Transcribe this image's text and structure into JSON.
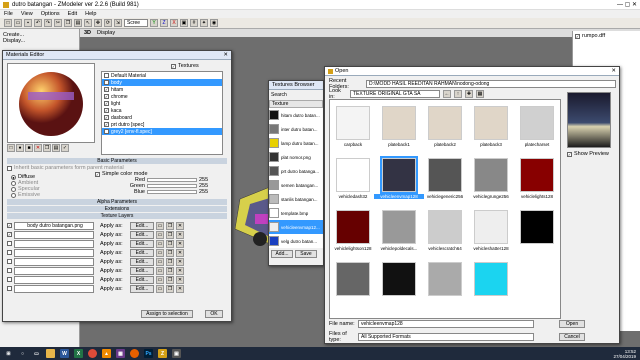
{
  "app": {
    "title": "dutro batangan - ZModeler ver 2.2.6 (Build 981)"
  },
  "menu": [
    "File",
    "View",
    "Options",
    "Edit",
    "Help"
  ],
  "toolbar": {
    "screen_label": "Scree"
  },
  "leftpanel": {
    "items": [
      "Create...",
      "Display..."
    ]
  },
  "viewport": {
    "tab": "3D",
    "display": "Display",
    "tree_item": "rumpo.dff"
  },
  "materials": {
    "title": "Materials Editor",
    "textures_label": "Textures",
    "items": [
      {
        "label": "Default Material",
        "checked": false
      },
      {
        "label": "body",
        "checked": false
      },
      {
        "label": "hitam",
        "checked": true
      },
      {
        "label": "chrome",
        "checked": true
      },
      {
        "label": "light",
        "checked": true
      },
      {
        "label": "kaca",
        "checked": true
      },
      {
        "label": "dasboard",
        "checked": true
      },
      {
        "label": "prt dutro [spec]",
        "checked": true
      },
      {
        "label": "grey2 [env-fl.spec]",
        "checked": true
      }
    ],
    "basic_params": "Basic Parameters",
    "inherit": "Inherit basic parameters form parent material",
    "diffuse": "Diffuse",
    "ambient": "Ambient",
    "specular": "Specular",
    "emissive": "Emissive",
    "simple_color": "Simple color mode",
    "red": "Red",
    "green": "Green",
    "blue": "Blue",
    "red_val": "255",
    "green_val": "255",
    "blue_val": "255",
    "alpha": "Alpha Parameters",
    "extensions": "Extensions",
    "texture_layers": "Texture Layers",
    "layers": [
      {
        "name": "body dutro batangan.png",
        "apply": "Apply as:",
        "edit": "Edit..."
      },
      {
        "name": "",
        "apply": "Apply as:",
        "edit": "Edit..."
      },
      {
        "name": "",
        "apply": "Apply as:",
        "edit": "Edit..."
      },
      {
        "name": "",
        "apply": "Apply as:",
        "edit": "Edit..."
      },
      {
        "name": "",
        "apply": "Apply as:",
        "edit": "Edit..."
      },
      {
        "name": "",
        "apply": "Apply as:",
        "edit": "Edit..."
      },
      {
        "name": "",
        "apply": "Apply as:",
        "edit": "Edit..."
      },
      {
        "name": "",
        "apply": "Apply as:",
        "edit": "Edit..."
      }
    ],
    "assign": "Assign to selection",
    "ok": "OK"
  },
  "texbrowser": {
    "title": "Textures Browser",
    "search": "Search",
    "header": "Texture",
    "items": [
      "hitam dutro batan...",
      "inter dutro batan...",
      "lamp dutro batan...",
      "plat nomor.png",
      "prt dutro batanga...",
      "semen batangan...",
      "stanlis batangan...",
      "template.bmp",
      "vehicleenvmap12...",
      "velg dutro batan..."
    ],
    "add": "Add...",
    "save": "Save"
  },
  "open": {
    "title": "Open",
    "recent_label": "Recent Folders:",
    "recent_value": "D:\\MODD HASIL REEDITAN RAHMAN\\nodong-odong",
    "lookin_label": "Look in:",
    "lookin_value": "TEXTURE ORIGINAL GTA SA",
    "thumbs": [
      "carpback",
      "plateback1",
      "plateback2",
      "plateback3",
      "platecharset",
      "vehicledash32",
      "vehicleenvmap128",
      "vehiclegeneric256",
      "vehiclegrunge256",
      "vehiclelights128",
      "vehiclelightson128",
      "vehiclepoldecals...",
      "vehiclescratch64",
      "vehicleshatter128",
      "",
      "",
      "",
      "",
      ""
    ],
    "show_preview": "Show Preview",
    "filename_label": "File name:",
    "filename_value": "vehicleenvmap128",
    "filetype_label": "Files of type:",
    "filetype_value": "All Supported Formats",
    "open_btn": "Open",
    "cancel_btn": "Cancel"
  },
  "taskbar": {
    "time": "13:52",
    "date": "27/04/2019"
  }
}
